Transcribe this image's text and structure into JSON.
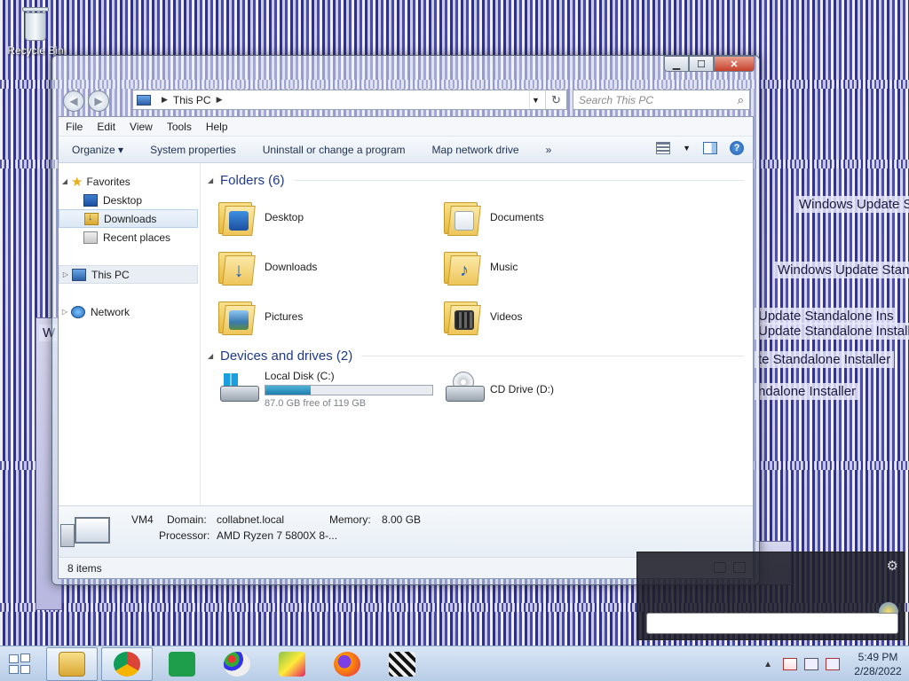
{
  "desktop": {
    "recycle_bin_label": "Recycle Bin"
  },
  "background_window_text": [
    "Windows Update S",
    "Windows Update Stan",
    "Update Standalone Ins",
    "Update Standalone Installe",
    "te Standalone Installer",
    "ndalone Installer",
    "W"
  ],
  "window": {
    "address_path": "This PC",
    "search_placeholder": "Search This PC",
    "caption": {
      "minimize": "▁",
      "maximize": "☐",
      "close": "✕"
    }
  },
  "menubar": [
    "File",
    "Edit",
    "View",
    "Tools",
    "Help"
  ],
  "commandbar": {
    "organize": "Organize ▾",
    "items": [
      "System properties",
      "Uninstall or change a program",
      "Map network drive"
    ],
    "more": "»"
  },
  "navpane": {
    "favorites": "Favorites",
    "fav_items": [
      "Desktop",
      "Downloads",
      "Recent places"
    ],
    "this_pc": "This PC",
    "network": "Network"
  },
  "folders": {
    "header": "Folders (6)",
    "items": [
      {
        "label": "Desktop",
        "icon": "desktop-folder-icon"
      },
      {
        "label": "Documents",
        "icon": "documents-folder-icon"
      },
      {
        "label": "Downloads",
        "icon": "downloads-folder-icon"
      },
      {
        "label": "Music",
        "icon": "music-folder-icon"
      },
      {
        "label": "Pictures",
        "icon": "pictures-folder-icon"
      },
      {
        "label": "Videos",
        "icon": "videos-folder-icon"
      }
    ]
  },
  "drives": {
    "header": "Devices and drives (2)",
    "local": {
      "label": "Local Disk (C:)",
      "free": "87.0 GB free of 119 GB",
      "used_fraction": 0.27
    },
    "cd": {
      "label": "CD Drive (D:)"
    }
  },
  "details": {
    "name": "VM4",
    "domain_k": "Domain:",
    "domain_v": "collabnet.local",
    "memory_k": "Memory:",
    "memory_v": "8.00 GB",
    "processor_k": "Processor:",
    "processor_v": "AMD Ryzen 7 5800X 8-..."
  },
  "status": {
    "items": "8 items"
  },
  "taskbar": {
    "time": "5:49 PM",
    "date": "2/28/2022",
    "apps": [
      "file-explorer",
      "chrome",
      "store",
      "paint",
      "media-player",
      "firefox",
      "clapper"
    ]
  },
  "colors": {
    "accent": "#1e3a8a",
    "taskbar": "#c7d8ee"
  }
}
